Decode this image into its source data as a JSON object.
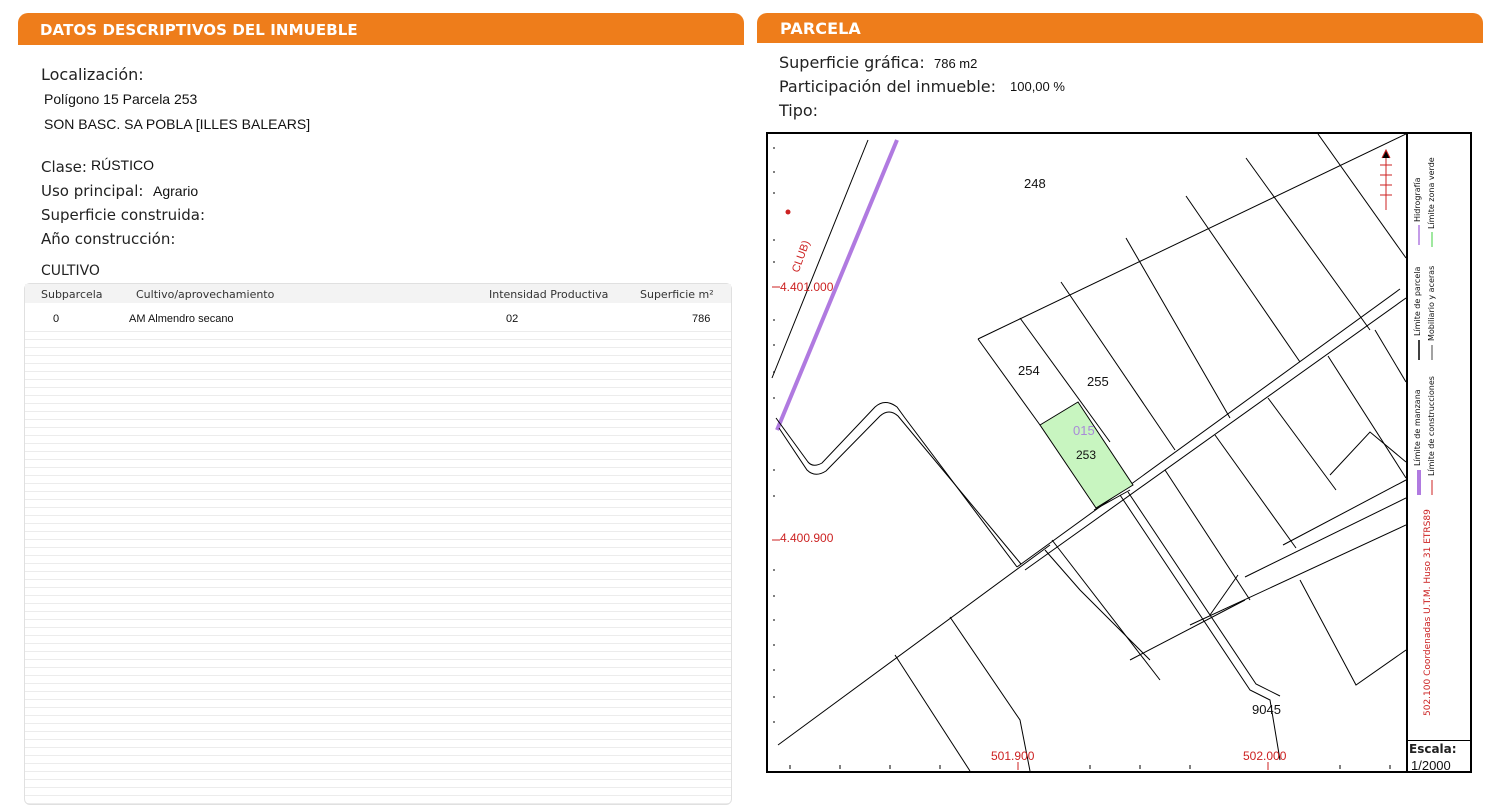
{
  "left_panel": {
    "title": "DATOS DESCRIPTIVOS DEL INMUEBLE",
    "localizacion_label": "Localización:",
    "address_line1": "Polígono 15 Parcela 253",
    "address_line2": "SON BASC. SA POBLA [ILLES BALEARS]",
    "clase_label": "Clase:",
    "clase_value": "RÚSTICO",
    "uso_label": "Uso principal:",
    "uso_value": "Agrario",
    "superficie_construida_label": "Superficie construida:",
    "anio_label": "Año construcción:"
  },
  "cultivo": {
    "title": "CULTIVO",
    "headers": [
      "Subparcela",
      "Cultivo/aprovechamiento",
      "Intensidad Productiva",
      "Superficie m²"
    ],
    "rows": [
      [
        "0",
        "AM Almendro secano",
        "02",
        "786"
      ]
    ]
  },
  "right_panel": {
    "title": "PARCELA",
    "superficie_label": "Superficie gráfica:",
    "superficie_value": "786 m2",
    "participacion_label": "Participación del inmueble:",
    "participacion_value": "100,00 %",
    "tipo_label": "Tipo:"
  },
  "map": {
    "parcel_labels": {
      "p248": "248",
      "p254": "254",
      "p255": "255",
      "p253": "253",
      "p015": "015",
      "p9045": "9045"
    },
    "road_label": "CLUB)",
    "coords": {
      "y_top": "4.401.000",
      "y_bottom": "4.400.900",
      "x_left": "501.900",
      "x_right": "502.000"
    },
    "legend": {
      "limite_manzana": "Límite de manzana",
      "limite_parcela": "Límite de parcela",
      "hidrografia": "Hidrografía",
      "limite_construcciones": "Límite de construcciones",
      "mobiliario": "Mobiliario y aceras",
      "limite_zona_verde": "Límite zona verde",
      "coord_note": "502.100 Coordenadas U.T.M. Huso 31 ETRS89"
    },
    "scale_label": "Escala:",
    "scale_value": "1/2000",
    "colors": {
      "parcel_fill": "#c8f5c0",
      "hydro": "#b07ae0",
      "coord_red": "#cc2222",
      "accent": "#ee7d1b"
    }
  }
}
